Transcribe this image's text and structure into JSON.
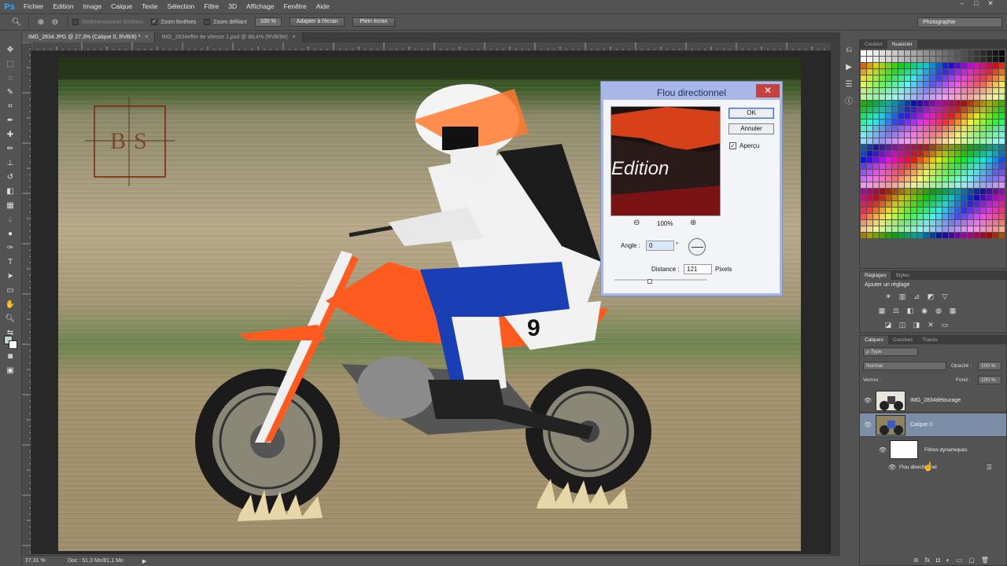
{
  "menubar": {
    "logo": "Ps",
    "items": [
      "Fichier",
      "Edition",
      "Image",
      "Calque",
      "Texte",
      "Sélection",
      "Filtre",
      "3D",
      "Affichage",
      "Fenêtre",
      "Aide"
    ],
    "win_minimize": "–",
    "win_maximize": "□",
    "win_close": "✕"
  },
  "options_bar": {
    "resize_windows": "Redimensionner fenêtres",
    "resize_checked": "",
    "zoom_windows": "Zoom fenêtres",
    "zoom_checked": "✓",
    "scrubby_zoom": "Zoom défilant",
    "zoom_value": "100 %",
    "fit_screen": "Adapter à l'écran",
    "fill_screen": "Plein écran",
    "workspace": "Photographie"
  },
  "tabs": [
    {
      "label": "IMG_2834.JPG @ 27,3% (Calque 0, RVB/8) *",
      "active": true,
      "close": "×"
    },
    {
      "label": "IMG_2834effet de vitesse 1.psd @ 88,4% (RVB/8#)",
      "active": false,
      "close": "×"
    }
  ],
  "status_bar": {
    "zoom": "27,31 %",
    "doc_info": "Doc : 51,3 Mo/81,1 Mo",
    "arrow": "▶"
  },
  "watermark": {
    "left": "B",
    "right": "S"
  },
  "filter_dialog": {
    "title": "Flou directionnel",
    "close": "✕",
    "ok": "OK",
    "cancel": "Annuler",
    "preview_label": "Aperçu",
    "preview_checked": "✓",
    "zoom_level": "100%",
    "zoom_out": "⊖",
    "zoom_in": "⊕",
    "preview_text": "Edition",
    "angle_label": "Angle :",
    "angle_value": "0",
    "angle_unit": "°",
    "distance_label": "Distance :",
    "distance_value": "121",
    "distance_unit": "Pixels"
  },
  "swatches_panel": {
    "tabs": [
      "Couleur",
      "Nuancier"
    ],
    "active_tab": "Nuancier"
  },
  "adjustments_panel": {
    "tabs": [
      "Réglages",
      "Styles"
    ],
    "heading": "Ajouter un réglage"
  },
  "layers_panel": {
    "tabs": [
      "Calques",
      "Couches",
      "Tracés"
    ],
    "filter_kind": "ρ Type",
    "blend_mode": "Normal",
    "opacity_label": "Opacité :",
    "opacity_value": "100 %",
    "lock_label": "Verrou :",
    "fill_label": "Fond :",
    "fill_value": "100 %",
    "layers": [
      {
        "name": "IMG_2834détourage",
        "selected": false
      },
      {
        "name": "Calque 0",
        "selected": true
      }
    ],
    "smart_filters_label": "Filtres dynamiques",
    "filter_item": "Flou directionnel",
    "bottom_icons": [
      "⊝",
      "fx",
      "◘",
      "◐",
      "▭",
      "▢",
      "🗑"
    ]
  },
  "colors": {
    "ui_bg": "#535353",
    "dialog_border": "#a7b8e8",
    "close_red": "#c94040",
    "selected_layer": "#7c8da8",
    "bike_orange": "#ff5a1f"
  }
}
